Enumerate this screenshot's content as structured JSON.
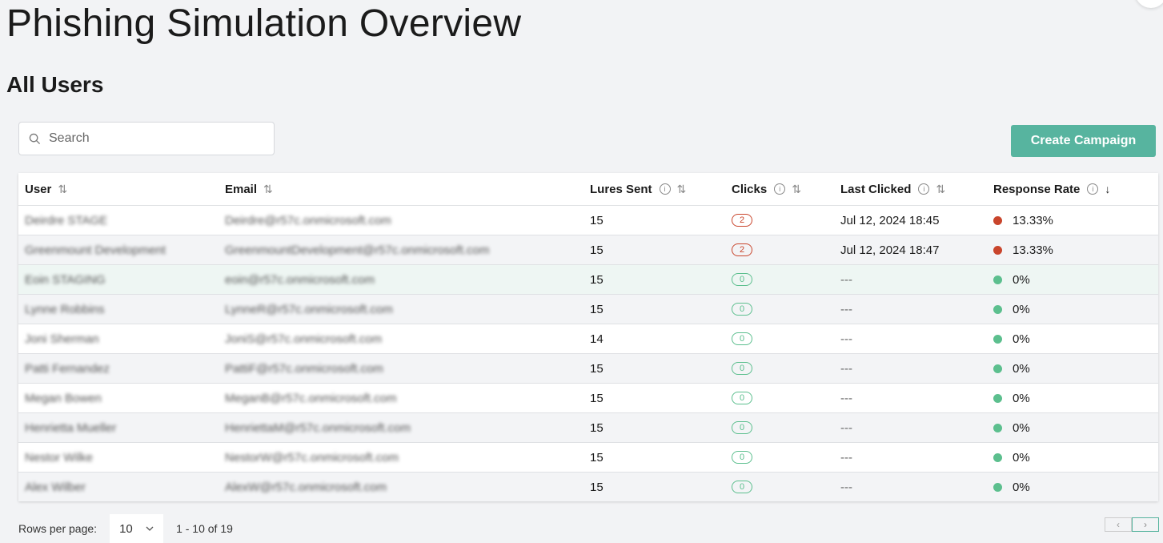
{
  "page": {
    "title": "Phishing Simulation Overview",
    "subtitle": "All Users"
  },
  "search": {
    "placeholder": "Search",
    "value": ""
  },
  "toolbar": {
    "create_label": "Create Campaign"
  },
  "colors": {
    "accent": "#57b49f",
    "danger": "#c9452c",
    "success": "#5cbf8e"
  },
  "table": {
    "columns": [
      {
        "label": "User",
        "sort": "sortable"
      },
      {
        "label": "Email",
        "sort": "sortable"
      },
      {
        "label": "Lures Sent",
        "info": true,
        "sort": "sortable"
      },
      {
        "label": "Clicks",
        "info": true,
        "sort": "sortable"
      },
      {
        "label": "Last Clicked",
        "info": true,
        "sort": "sortable"
      },
      {
        "label": "Response Rate",
        "info": true,
        "sort": "descending"
      }
    ],
    "rows": [
      {
        "user": "Deirdre STAGE",
        "email": "Deirdre@r57c.onmicrosoft.com",
        "lures": "15",
        "clicks": "2",
        "last": "Jul 12, 2024 18:45",
        "rate": "13.33%",
        "status": "danger"
      },
      {
        "user": "Greenmount Development",
        "email": "GreenmountDevelopment@r57c.onmicrosoft.com",
        "lures": "15",
        "clicks": "2",
        "last": "Jul 12, 2024 18:47",
        "rate": "13.33%",
        "status": "danger"
      },
      {
        "user": "Eoin STAGING",
        "email": "eoin@r57c.onmicrosoft.com",
        "lures": "15",
        "clicks": "0",
        "last": "---",
        "rate": "0%",
        "status": "success"
      },
      {
        "user": "Lynne Robbins",
        "email": "LynneR@r57c.onmicrosoft.com",
        "lures": "15",
        "clicks": "0",
        "last": "---",
        "rate": "0%",
        "status": "success"
      },
      {
        "user": "Joni Sherman",
        "email": "JoniS@r57c.onmicrosoft.com",
        "lures": "14",
        "clicks": "0",
        "last": "---",
        "rate": "0%",
        "status": "success"
      },
      {
        "user": "Patti Fernandez",
        "email": "PattiF@r57c.onmicrosoft.com",
        "lures": "15",
        "clicks": "0",
        "last": "---",
        "rate": "0%",
        "status": "success"
      },
      {
        "user": "Megan Bowen",
        "email": "MeganB@r57c.onmicrosoft.com",
        "lures": "15",
        "clicks": "0",
        "last": "---",
        "rate": "0%",
        "status": "success"
      },
      {
        "user": "Henrietta Mueller",
        "email": "HenriettaM@r57c.onmicrosoft.com",
        "lures": "15",
        "clicks": "0",
        "last": "---",
        "rate": "0%",
        "status": "success"
      },
      {
        "user": "Nestor Wilke",
        "email": "NestorW@r57c.onmicrosoft.com",
        "lures": "15",
        "clicks": "0",
        "last": "---",
        "rate": "0%",
        "status": "success"
      },
      {
        "user": "Alex Wilber",
        "email": "AlexW@r57c.onmicrosoft.com",
        "lures": "15",
        "clicks": "0",
        "last": "---",
        "rate": "0%",
        "status": "success"
      }
    ]
  },
  "pagination": {
    "rows_label": "Rows per page:",
    "rows_value": "10",
    "range": "1 - 10 of 19"
  }
}
